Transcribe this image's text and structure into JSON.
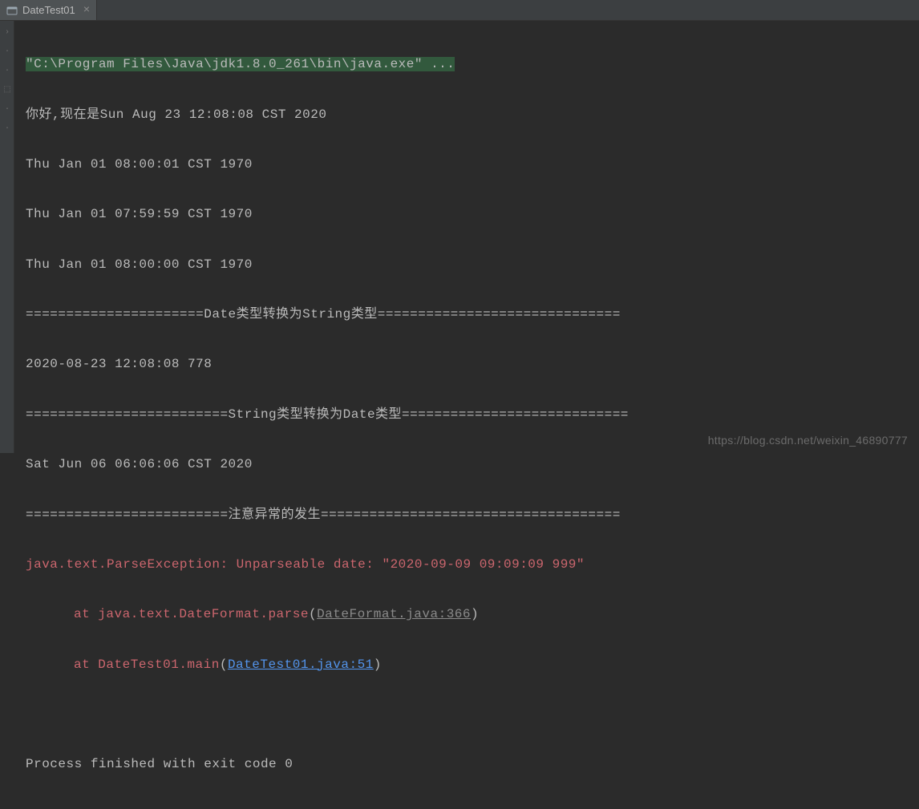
{
  "tab": {
    "label": "DateTest01",
    "close": "×"
  },
  "console": {
    "cmd": "\"C:\\Program Files\\Java\\jdk1.8.0_261\\bin\\java.exe\" ...",
    "line1": "你好,现在是Sun Aug 23 12:08:08 CST 2020",
    "line2": "Thu Jan 01 08:00:01 CST 1970",
    "line3": "Thu Jan 01 07:59:59 CST 1970",
    "line4": "Thu Jan 01 08:00:00 CST 1970",
    "sep1": "======================Date类型转换为String类型==============================",
    "line5": "2020-08-23 12:08:08 778",
    "sep2": "=========================String类型转换为Date类型============================",
    "line6": "Sat Jun 06 06:06:06 CST 2020",
    "sep3": "=========================注意异常的发生=====================================",
    "error1": "java.text.ParseException: Unparseable date: \"2020-09-09 09:09:09 999\"",
    "at1_prefix": "at java.text.DateFormat.parse",
    "at1_link": "DateFormat.java:366",
    "at2_prefix": "at DateTest01.main",
    "at2_link": "DateTest01.java:51",
    "exit": "Process finished with exit code 0"
  },
  "watermark": "https://blog.csdn.net/weixin_46890777"
}
